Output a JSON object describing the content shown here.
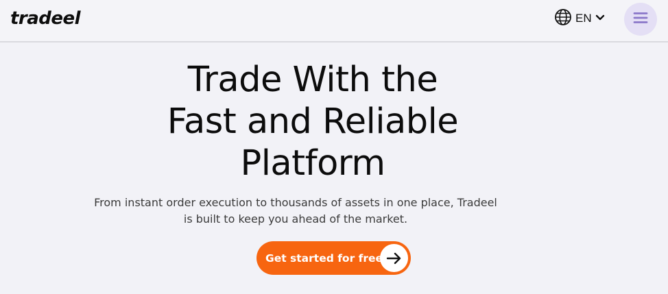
{
  "header": {
    "logo_text": "tradeel",
    "language": {
      "icon": "globe-icon",
      "code": "EN",
      "chevron_icon": "chevron-down-icon"
    },
    "menu_icon": "hamburger-menu-icon"
  },
  "hero": {
    "title_lines": [
      "Trade With the",
      "Fast and Reliable",
      "Platform"
    ],
    "subtitle_lines": [
      "From instant order execution to thousands of assets in one place, Tradeel",
      "is built to keep you ahead of the market."
    ],
    "cta": {
      "label": "Get started for free",
      "icon": "arrow-right-icon"
    }
  },
  "colors": {
    "accent": "#f76510",
    "menu_bg": "#e4dff5",
    "menu_icon": "#8a77c9",
    "background": "#f2f2f7"
  }
}
